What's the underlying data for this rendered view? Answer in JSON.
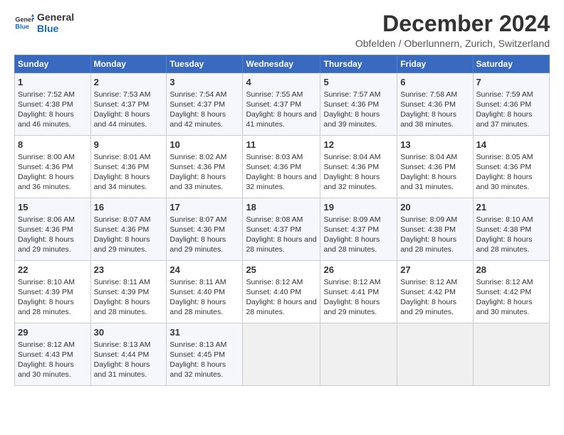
{
  "logo": {
    "line1": "General",
    "line2": "Blue"
  },
  "title": "December 2024",
  "subtitle": "Obfelden / Oberlunnern, Zurich, Switzerland",
  "headers": [
    "Sunday",
    "Monday",
    "Tuesday",
    "Wednesday",
    "Thursday",
    "Friday",
    "Saturday"
  ],
  "weeks": [
    [
      {
        "day": "1",
        "sunrise": "7:52 AM",
        "sunset": "4:38 PM",
        "daylight": "8 hours and 46 minutes."
      },
      {
        "day": "2",
        "sunrise": "7:53 AM",
        "sunset": "4:37 PM",
        "daylight": "8 hours and 44 minutes."
      },
      {
        "day": "3",
        "sunrise": "7:54 AM",
        "sunset": "4:37 PM",
        "daylight": "8 hours and 42 minutes."
      },
      {
        "day": "4",
        "sunrise": "7:55 AM",
        "sunset": "4:37 PM",
        "daylight": "8 hours and 41 minutes."
      },
      {
        "day": "5",
        "sunrise": "7:57 AM",
        "sunset": "4:36 PM",
        "daylight": "8 hours and 39 minutes."
      },
      {
        "day": "6",
        "sunrise": "7:58 AM",
        "sunset": "4:36 PM",
        "daylight": "8 hours and 38 minutes."
      },
      {
        "day": "7",
        "sunrise": "7:59 AM",
        "sunset": "4:36 PM",
        "daylight": "8 hours and 37 minutes."
      }
    ],
    [
      {
        "day": "8",
        "sunrise": "8:00 AM",
        "sunset": "4:36 PM",
        "daylight": "8 hours and 36 minutes."
      },
      {
        "day": "9",
        "sunrise": "8:01 AM",
        "sunset": "4:36 PM",
        "daylight": "8 hours and 34 minutes."
      },
      {
        "day": "10",
        "sunrise": "8:02 AM",
        "sunset": "4:36 PM",
        "daylight": "8 hours and 33 minutes."
      },
      {
        "day": "11",
        "sunrise": "8:03 AM",
        "sunset": "4:36 PM",
        "daylight": "8 hours and 32 minutes."
      },
      {
        "day": "12",
        "sunrise": "8:04 AM",
        "sunset": "4:36 PM",
        "daylight": "8 hours and 32 minutes."
      },
      {
        "day": "13",
        "sunrise": "8:04 AM",
        "sunset": "4:36 PM",
        "daylight": "8 hours and 31 minutes."
      },
      {
        "day": "14",
        "sunrise": "8:05 AM",
        "sunset": "4:36 PM",
        "daylight": "8 hours and 30 minutes."
      }
    ],
    [
      {
        "day": "15",
        "sunrise": "8:06 AM",
        "sunset": "4:36 PM",
        "daylight": "8 hours and 29 minutes."
      },
      {
        "day": "16",
        "sunrise": "8:07 AM",
        "sunset": "4:36 PM",
        "daylight": "8 hours and 29 minutes."
      },
      {
        "day": "17",
        "sunrise": "8:07 AM",
        "sunset": "4:36 PM",
        "daylight": "8 hours and 29 minutes."
      },
      {
        "day": "18",
        "sunrise": "8:08 AM",
        "sunset": "4:37 PM",
        "daylight": "8 hours and 28 minutes."
      },
      {
        "day": "19",
        "sunrise": "8:09 AM",
        "sunset": "4:37 PM",
        "daylight": "8 hours and 28 minutes."
      },
      {
        "day": "20",
        "sunrise": "8:09 AM",
        "sunset": "4:38 PM",
        "daylight": "8 hours and 28 minutes."
      },
      {
        "day": "21",
        "sunrise": "8:10 AM",
        "sunset": "4:38 PM",
        "daylight": "8 hours and 28 minutes."
      }
    ],
    [
      {
        "day": "22",
        "sunrise": "8:10 AM",
        "sunset": "4:39 PM",
        "daylight": "8 hours and 28 minutes."
      },
      {
        "day": "23",
        "sunrise": "8:11 AM",
        "sunset": "4:39 PM",
        "daylight": "8 hours and 28 minutes."
      },
      {
        "day": "24",
        "sunrise": "8:11 AM",
        "sunset": "4:40 PM",
        "daylight": "8 hours and 28 minutes."
      },
      {
        "day": "25",
        "sunrise": "8:12 AM",
        "sunset": "4:40 PM",
        "daylight": "8 hours and 28 minutes."
      },
      {
        "day": "26",
        "sunrise": "8:12 AM",
        "sunset": "4:41 PM",
        "daylight": "8 hours and 29 minutes."
      },
      {
        "day": "27",
        "sunrise": "8:12 AM",
        "sunset": "4:42 PM",
        "daylight": "8 hours and 29 minutes."
      },
      {
        "day": "28",
        "sunrise": "8:12 AM",
        "sunset": "4:42 PM",
        "daylight": "8 hours and 30 minutes."
      }
    ],
    [
      {
        "day": "29",
        "sunrise": "8:12 AM",
        "sunset": "4:43 PM",
        "daylight": "8 hours and 30 minutes."
      },
      {
        "day": "30",
        "sunrise": "8:13 AM",
        "sunset": "4:44 PM",
        "daylight": "8 hours and 31 minutes."
      },
      {
        "day": "31",
        "sunrise": "8:13 AM",
        "sunset": "4:45 PM",
        "daylight": "8 hours and 32 minutes."
      },
      null,
      null,
      null,
      null
    ]
  ]
}
